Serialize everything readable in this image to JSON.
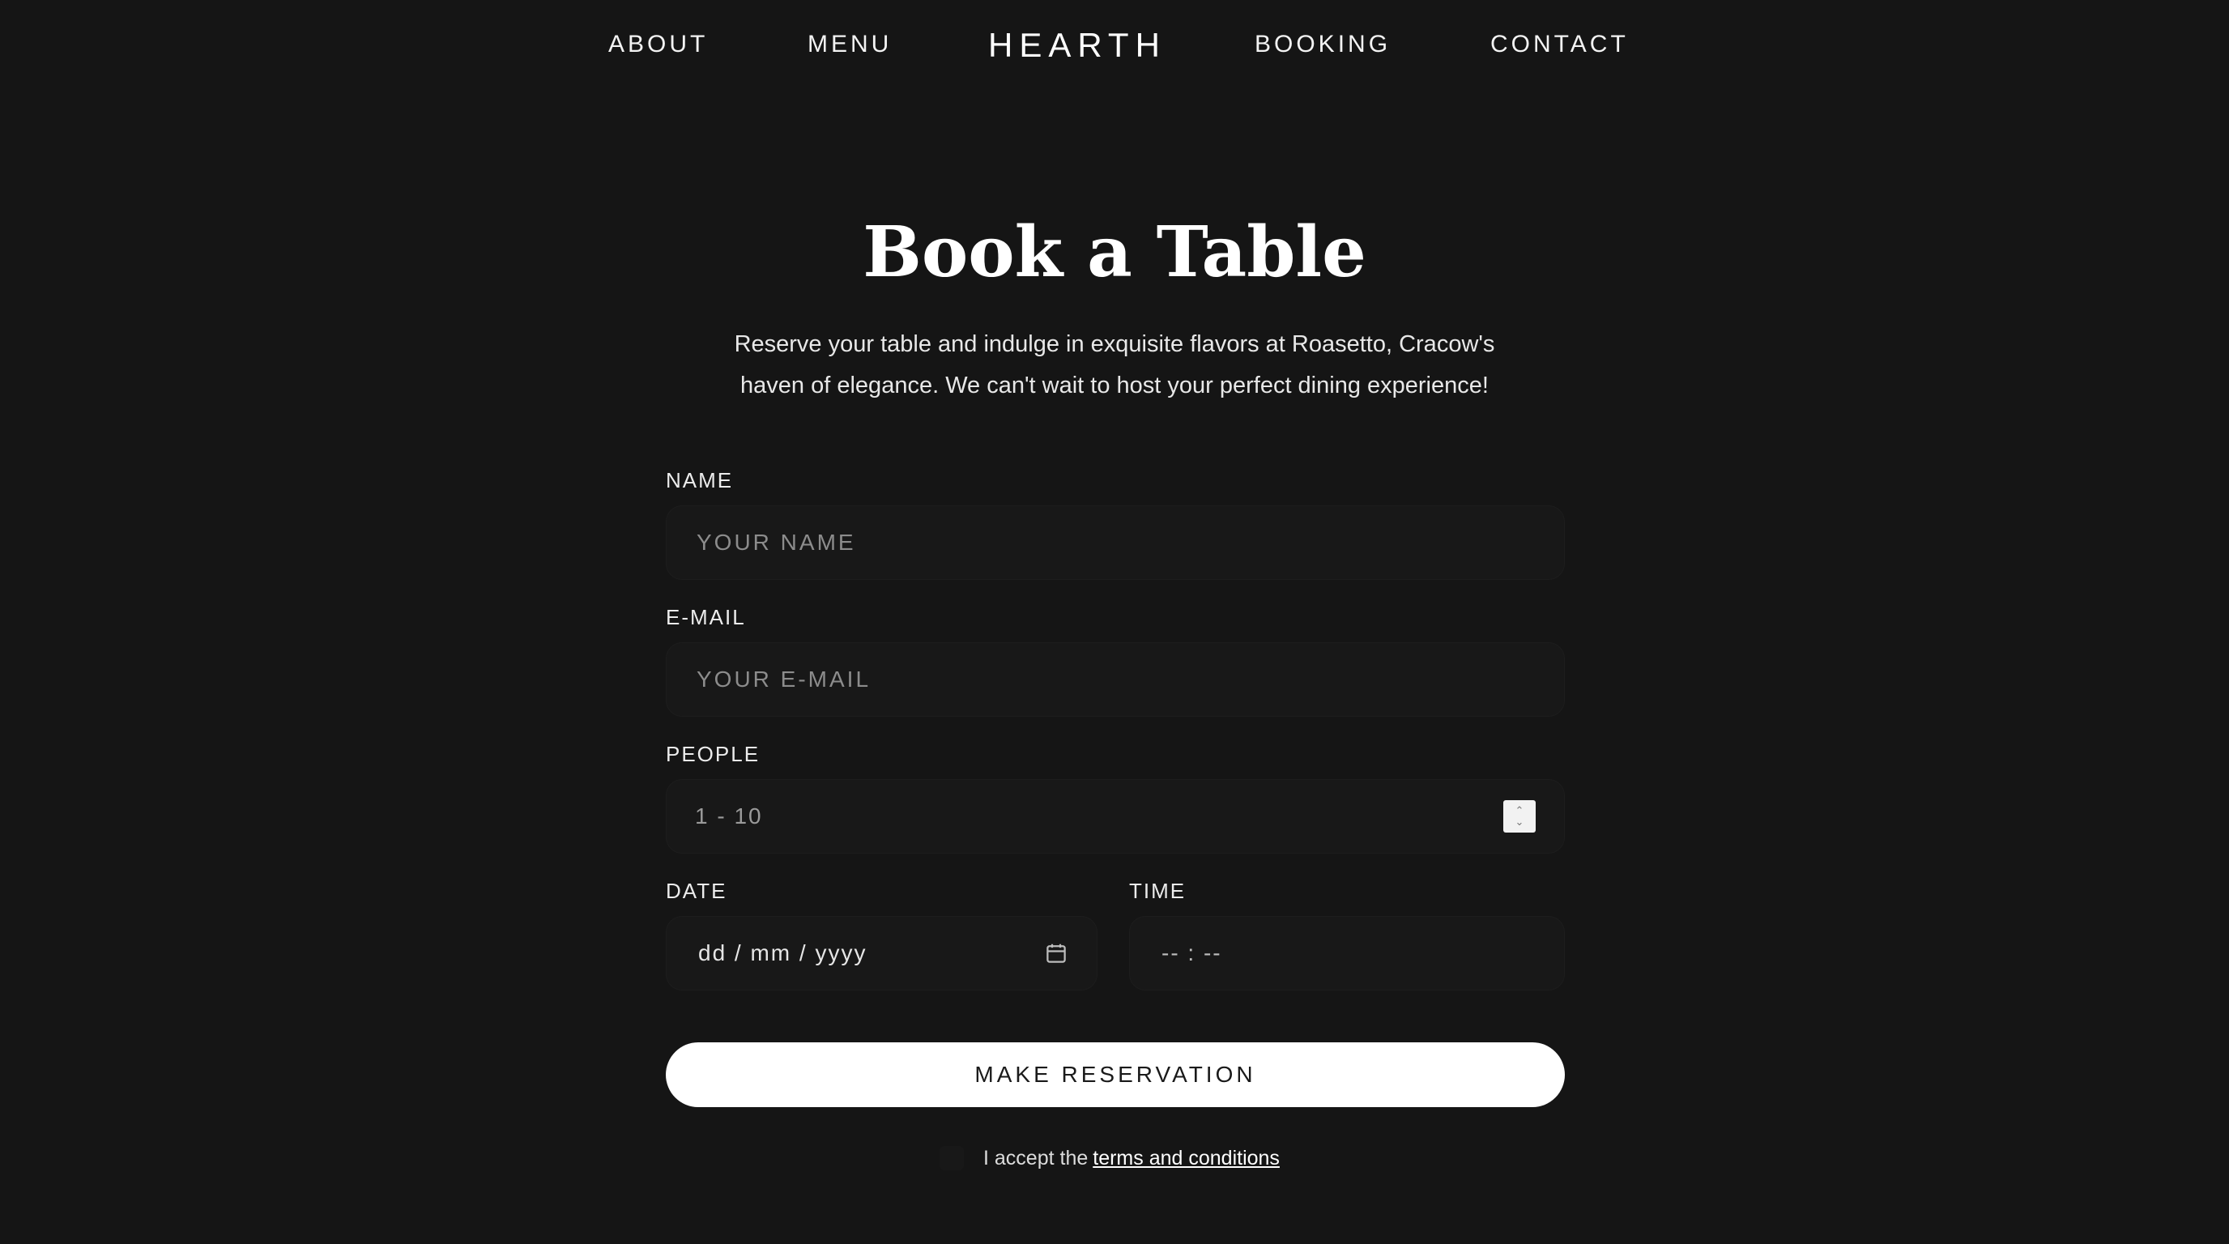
{
  "nav": {
    "items": [
      {
        "label": "ABOUT"
      },
      {
        "label": "MENU"
      },
      {
        "label": "BOOKING"
      },
      {
        "label": "CONTACT"
      }
    ],
    "logo": "HEARTH"
  },
  "hero": {
    "title": "Book a Table",
    "description_line1": "Reserve your table and indulge in exquisite flavors at Roasetto, Cracow's",
    "description_line2": "haven of elegance. We can't wait to host your perfect dining experience!"
  },
  "form": {
    "name": {
      "label": "NAME",
      "placeholder": "YOUR NAME",
      "value": ""
    },
    "email": {
      "label": "E-MAIL",
      "placeholder": "YOUR E-MAIL",
      "value": ""
    },
    "people": {
      "label": "PEOPLE",
      "placeholder": "1 - 10",
      "value": ""
    },
    "date": {
      "label": "DATE",
      "placeholder": "dd / mm / yyyy",
      "icon": "calendar-icon"
    },
    "time": {
      "label": "TIME",
      "placeholder": "-- : --"
    },
    "submit_label": "MAKE RESERVATION",
    "terms": {
      "prefix": "I accept the",
      "link": "terms and conditions",
      "checked": false
    }
  },
  "colors": {
    "background": "#151515",
    "field_background": "#181818",
    "text": "#ffffff",
    "placeholder": "#8c8c8c",
    "button_background": "#ffffff",
    "button_text": "#1a1a1a"
  }
}
